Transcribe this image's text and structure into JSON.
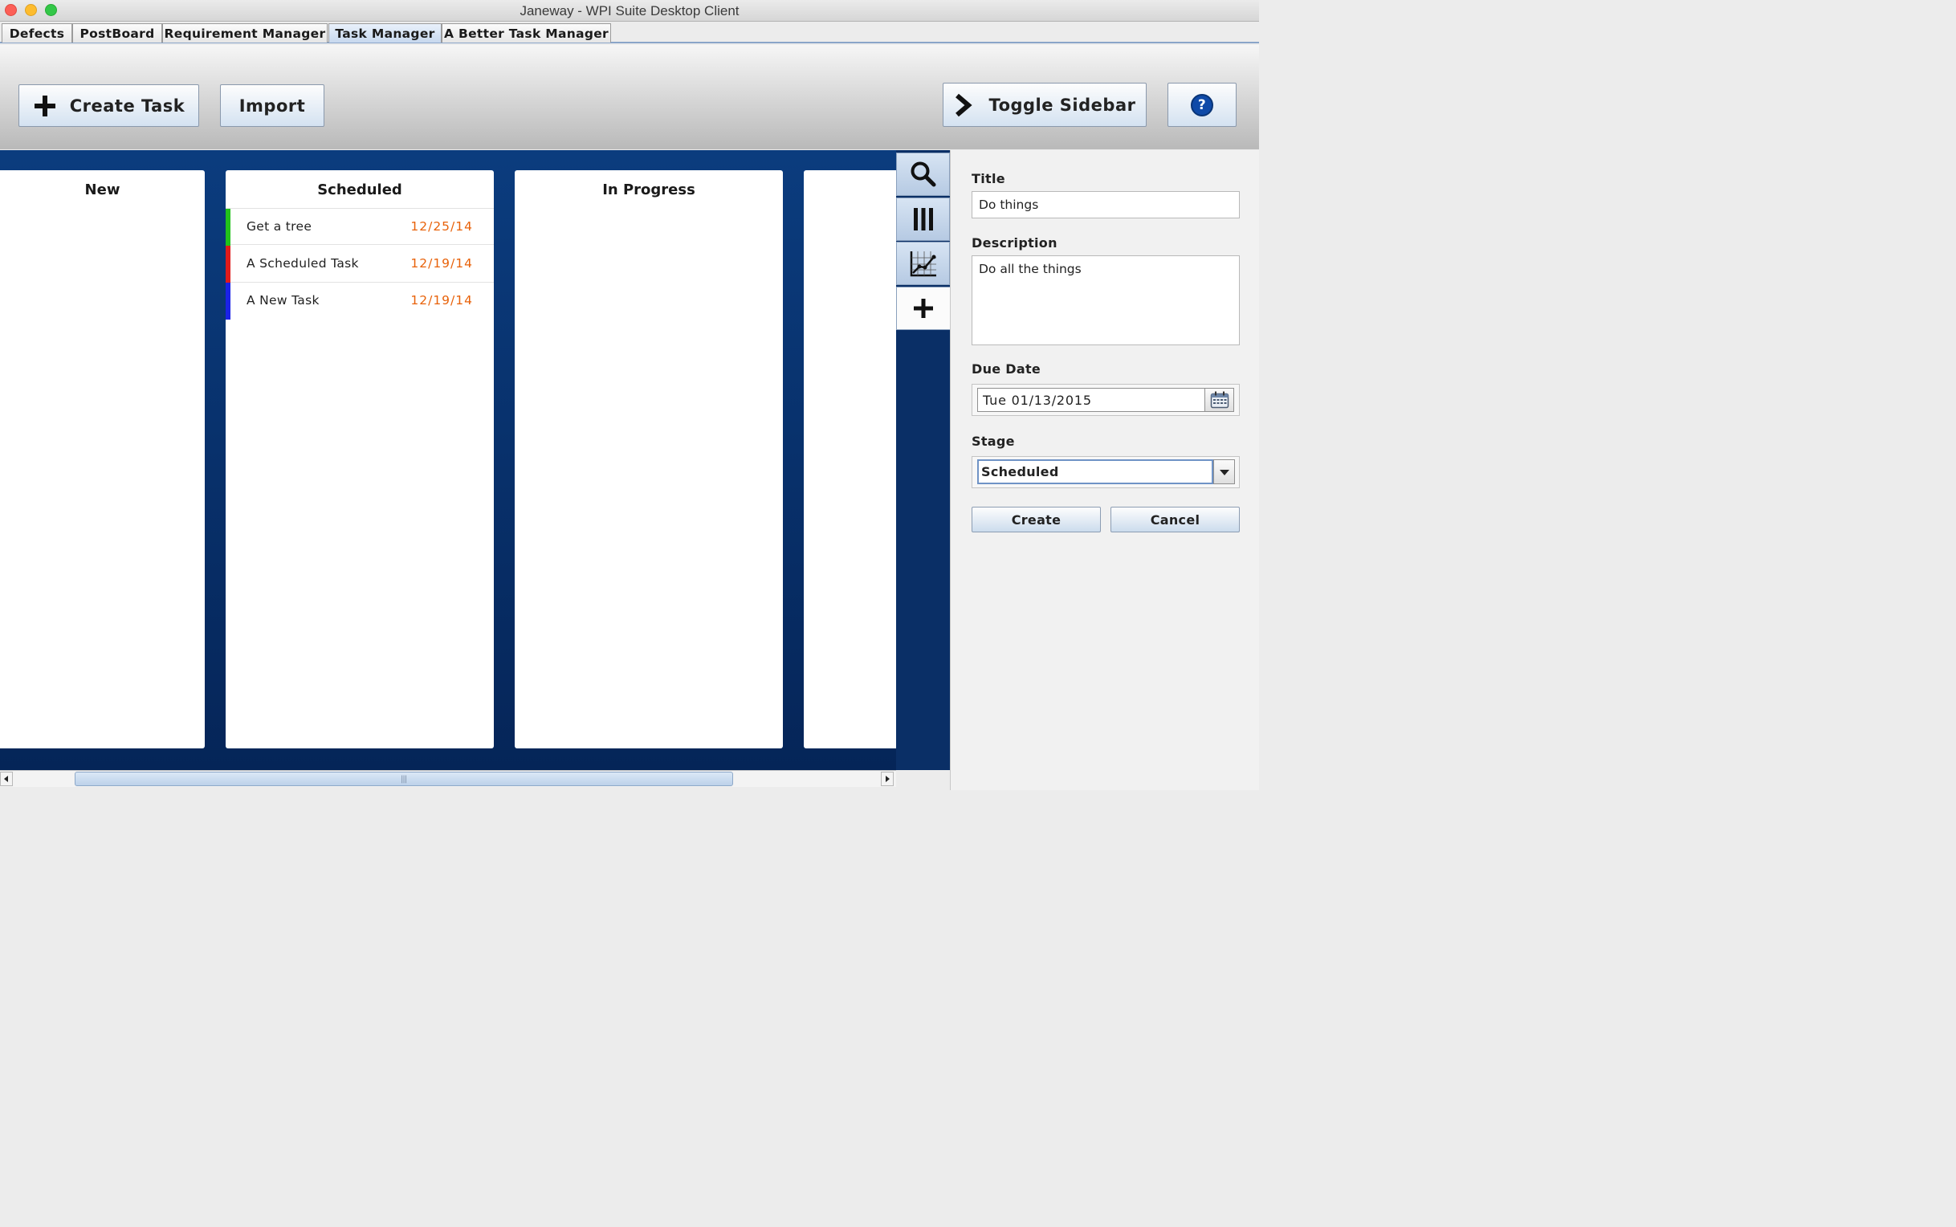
{
  "window": {
    "title": "Janeway - WPI Suite Desktop Client"
  },
  "tabs": [
    {
      "label": "Defects"
    },
    {
      "label": "PostBoard"
    },
    {
      "label": "Requirement Manager"
    },
    {
      "label": "Task Manager"
    },
    {
      "label": "A Better Task Manager"
    }
  ],
  "toolbar": {
    "create_task": "Create Task",
    "import": "Import",
    "toggle_sidebar": "Toggle Sidebar",
    "help": "?"
  },
  "columns": [
    {
      "title": "New",
      "tasks": []
    },
    {
      "title": "Scheduled",
      "tasks": [
        {
          "name": "Get a tree",
          "date": "12/25/14",
          "color": "#22c21a"
        },
        {
          "name": "A Scheduled Task",
          "date": "12/19/14",
          "color": "#e01b1b"
        },
        {
          "name": "A New Task",
          "date": "12/19/14",
          "color": "#1b22e6"
        }
      ]
    },
    {
      "title": "In Progress",
      "tasks": []
    },
    {
      "title": "",
      "tasks": []
    }
  ],
  "sidebar_tabs": [
    "search-icon",
    "columns-icon",
    "chart-icon",
    "plus-icon"
  ],
  "form": {
    "title_label": "Title",
    "title_value": "Do things",
    "description_label": "Description",
    "description_value": "Do all the things",
    "due_date_label": "Due Date",
    "due_date_value": "Tue 01/13/2015",
    "stage_label": "Stage",
    "stage_value": "Scheduled",
    "create_label": "Create",
    "cancel_label": "Cancel"
  },
  "colors": {
    "board_bg": "#0b3c7e",
    "date_text": "#e8620a",
    "help_icon": "#0f4aa8"
  }
}
